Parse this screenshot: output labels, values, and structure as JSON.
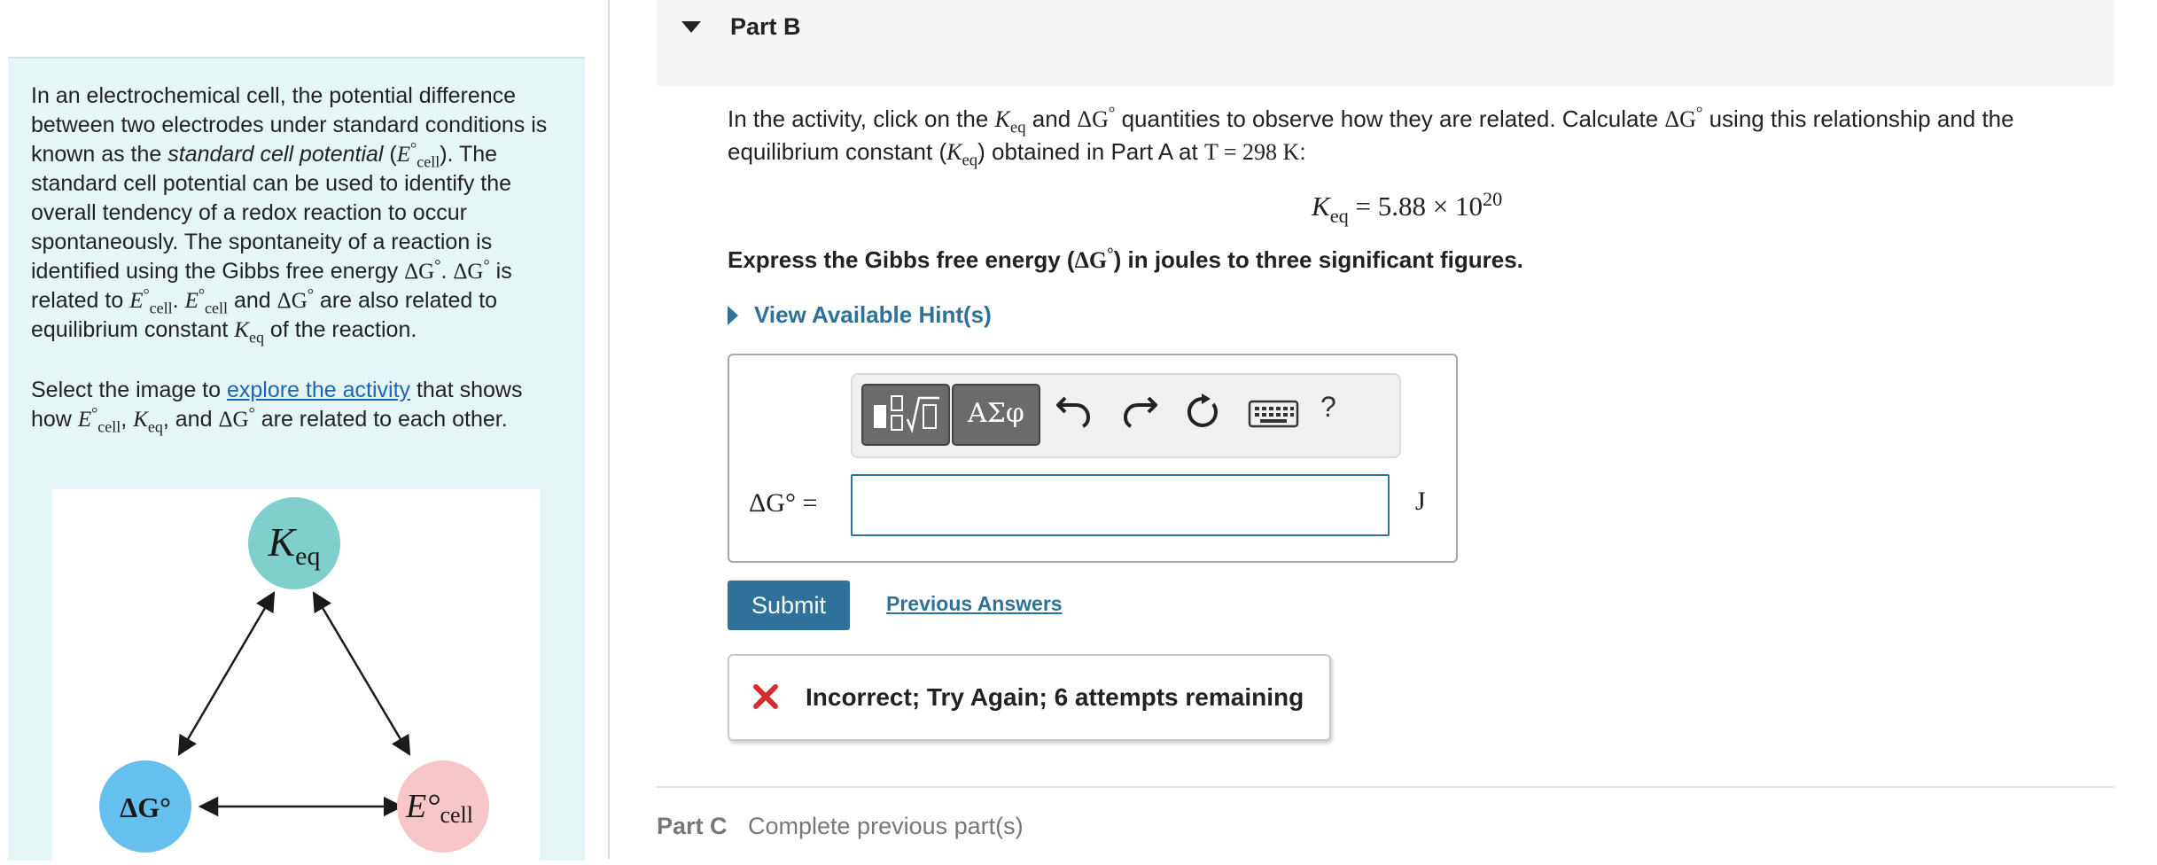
{
  "left_panel": {
    "intro": {
      "p1": "In an electrochemical cell, the potential difference between two electrodes under standard conditions is known as the ",
      "standard_term": "standard cell potential",
      "p2": " (",
      "p3": "). The standard cell potential can be used to identify the overall tendency of a redox reaction to occur spontaneously. The spontaneity of a reaction is identified using the Gibbs free energy ",
      "p4": ". ",
      "p5": " is related to ",
      "p6": ". ",
      "p7": " and ",
      "p8": " are also related to equilibrium constant ",
      "p9": " of the reaction."
    },
    "activity": {
      "p1": "Select the image to ",
      "link": "explore the activity",
      "p2": " that shows how ",
      "sep1": ", ",
      "p3": ", and ",
      "p4": " are related to each other."
    },
    "symbols": {
      "delta_g": "ΔG",
      "degree": "°",
      "e": "E",
      "cell": "cell",
      "k": "K",
      "eq": "eq"
    },
    "diagram": {
      "node_keq": "K",
      "node_keq_sub": "eq",
      "node_dg": "ΔG°",
      "node_ecell": "E°",
      "node_ecell_sub": "cell",
      "colors": {
        "keq": "#7fd0cc",
        "dg": "#66c0ef",
        "ecell": "#f7c6c8"
      }
    }
  },
  "part_b": {
    "title": "Part B",
    "question": {
      "p1": "In the activity, click on the ",
      "p2": " and ",
      "p3": " quantities to observe how they are related. Calculate ",
      "p4": " using this relationship and the equilibrium constant (",
      "p5": ") obtained in Part A at ",
      "t_expr": "T = 298 K",
      "p6": ":"
    },
    "keq_value": {
      "lhs": "K",
      "lhs_sub": "eq",
      "equals": " = ",
      "mantissa": "5.88 × 10",
      "exponent": "20"
    },
    "instruction": {
      "p1": "Express the Gibbs free energy (",
      "p2": ") in joules to three significant figures."
    },
    "hint_label": "View Available Hint(s)",
    "answer": {
      "label": "ΔG° =",
      "value": "",
      "placeholder": "",
      "unit": "J"
    },
    "toolbar": {
      "symbols_label": "ΑΣφ",
      "help_label": "?",
      "icons": [
        "templates-icon",
        "symbols-icon",
        "undo-icon",
        "redo-icon",
        "reset-icon",
        "keyboard-icon",
        "help-icon"
      ]
    },
    "submit_label": "Submit",
    "previous_answers_label": "Previous Answers",
    "feedback": {
      "text": "Incorrect; Try Again; 6 attempts remaining",
      "icon": "x-mark-icon",
      "color": "#d32f2f"
    }
  },
  "part_c": {
    "title": "Part C",
    "status": "Complete previous part(s)"
  },
  "colors": {
    "accent": "#2e7199",
    "left_panel_bg": "#e6f5f5",
    "link": "#1a66b3"
  }
}
